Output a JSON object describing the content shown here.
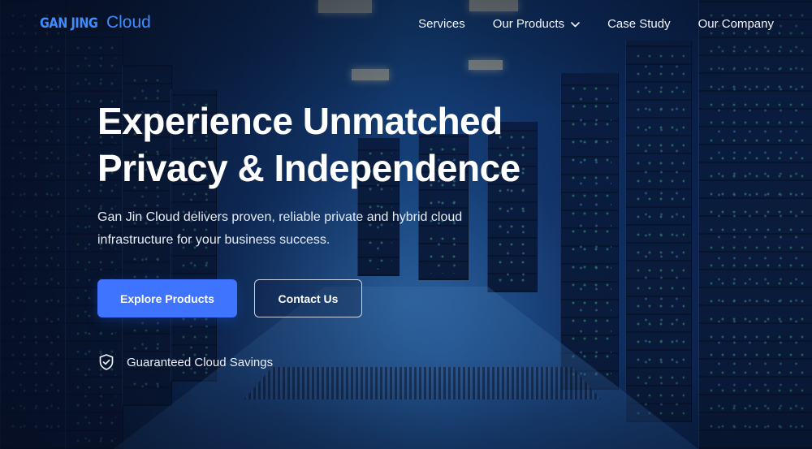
{
  "header": {
    "logo": {
      "bold": "GAN JING",
      "light": "Cloud"
    },
    "nav": [
      {
        "label": "Services",
        "icon": ""
      },
      {
        "label": "Our Products",
        "icon": "chevron-down-icon"
      },
      {
        "label": "Case Study",
        "icon": ""
      },
      {
        "label": "Our Company",
        "icon": ""
      }
    ]
  },
  "hero": {
    "headline_line1": "Experience Unmatched",
    "headline_line2": "Privacy & Independence",
    "subtext": "Gan Jin Cloud delivers proven, reliable private and hybrid cloud infrastructure for your business success.",
    "primary_button": "Explore Products",
    "secondary_button": "Contact Us",
    "guarantee": {
      "icon": "shield-check-icon",
      "text": "Guaranteed Cloud Savings"
    }
  },
  "colors": {
    "accent": "#3e74ff",
    "logo": "#3f8cff",
    "background": "#0d2a58"
  }
}
